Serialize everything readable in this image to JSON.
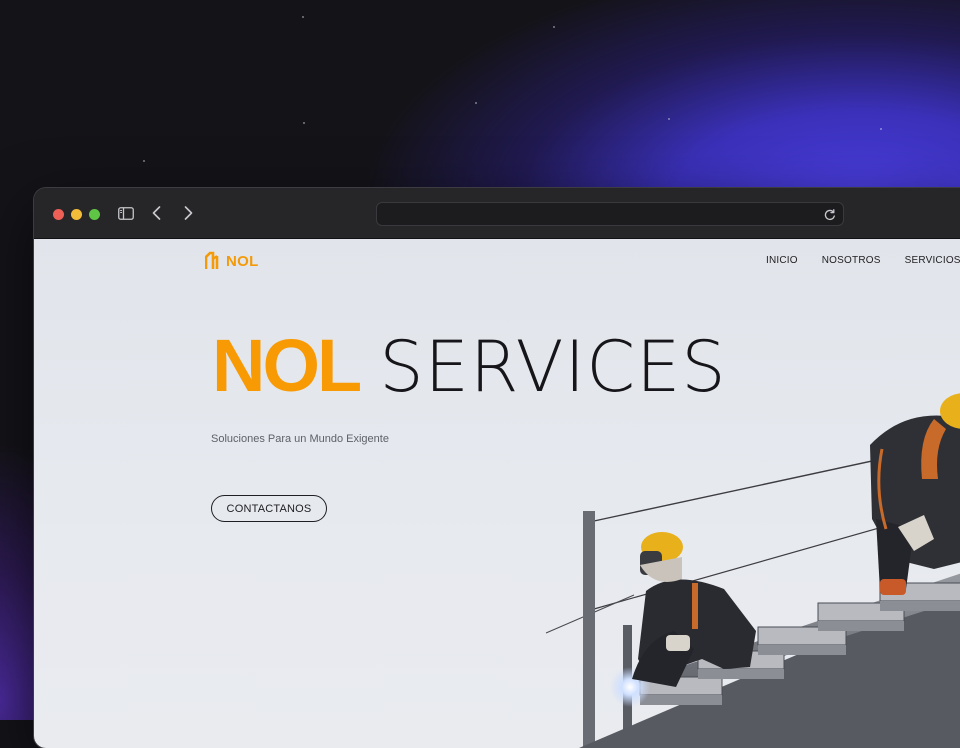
{
  "browser": {
    "address": "",
    "icons": [
      "sidebar-icon",
      "back-icon",
      "forward-icon",
      "reload-icon"
    ]
  },
  "site": {
    "logo_text": "NOL",
    "nav": [
      "INICIO",
      "NOSOTROS",
      "SERVICIOS"
    ],
    "hero": {
      "title_brand": "NOL",
      "title_rest": "SERVICES",
      "subtitle": "Soluciones Para un Mundo Exigente",
      "cta_label": "CONTACTANOS"
    }
  },
  "colors": {
    "accent": "#f89a04",
    "page_bg": "#e4e7ec",
    "text_dark": "#15151a"
  }
}
